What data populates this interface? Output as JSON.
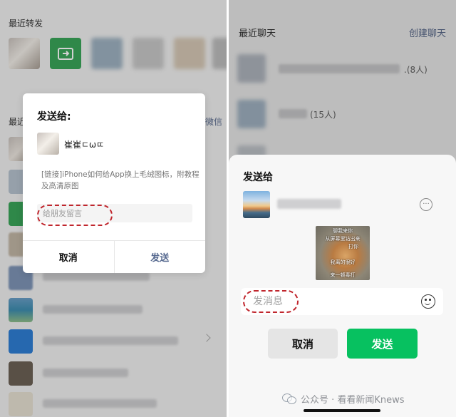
{
  "left": {
    "recent_forward_label": "最近转发",
    "recent_chats_label": "最近",
    "right_edge_hint": "微信",
    "dialog": {
      "title": "发送给:",
      "recipient_name": "崔崔ㄷωㄸ",
      "shared_link": "[链接]iPhone如何给App换上毛绒图标，附教程及高清原图",
      "message_placeholder": "给朋友留言",
      "cancel_label": "取消",
      "send_label": "发送"
    }
  },
  "right": {
    "recent_chats_label": "最近聊天",
    "create_chat_label": "创建聊天",
    "chat_counts": [
      ".(8人)",
      "(15人)"
    ],
    "sheet": {
      "title": "发送给",
      "more_icon_glyph": "···",
      "sticker_captions": [
        "聊我来你",
        "从屏幕里钻出来",
        "打你",
        "我离的很好",
        "来一顿毒打"
      ],
      "message_placeholder": "发消息",
      "cancel_label": "取消",
      "send_label": "发送"
    }
  },
  "watermark": {
    "text": "公众号 · 看看新闻Knews"
  },
  "colors": {
    "wechat_green": "#07c160",
    "send_text_blue": "#56698f",
    "annotation_red": "#c0262d",
    "link_blue": "#5b6c8f"
  }
}
